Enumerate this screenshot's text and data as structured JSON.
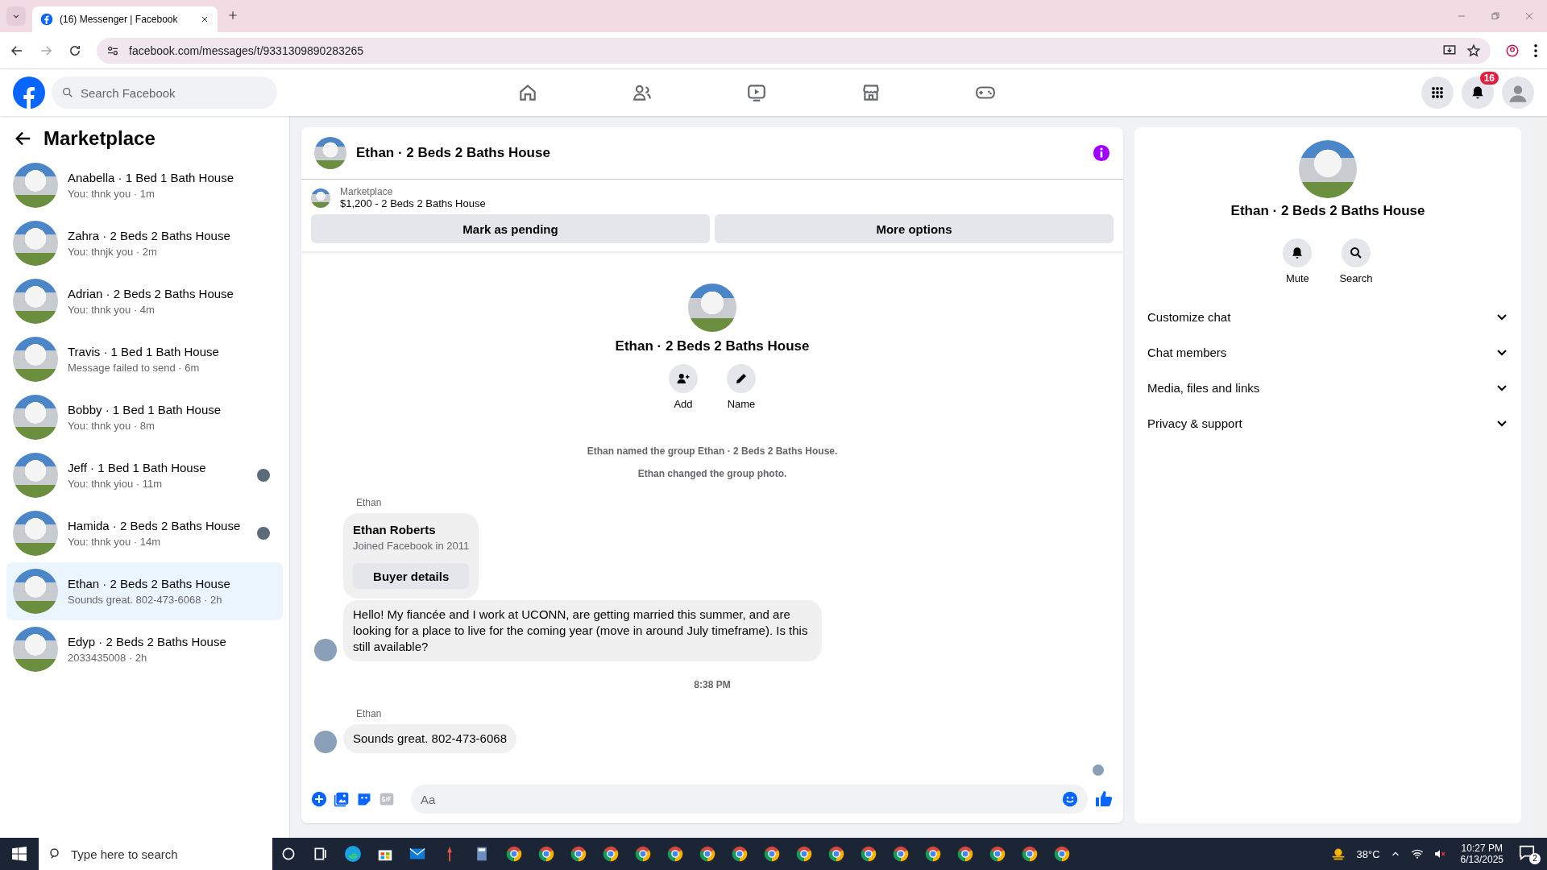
{
  "browser": {
    "tab_title": "(16) Messenger | Facebook",
    "url": "facebook.com/messages/t/9331309890283265"
  },
  "header": {
    "search_placeholder": "Search Facebook",
    "notification_count": "16"
  },
  "sidebar": {
    "title": "Marketplace",
    "conversations": [
      {
        "title": "Anabella · 1 Bed 1 Bath House",
        "preview": "You: thnk you · 1m",
        "selected": false,
        "seen": false
      },
      {
        "title": "Zahra · 2 Beds 2 Baths House",
        "preview": "You: thnjk you · 2m",
        "selected": false,
        "seen": false
      },
      {
        "title": "Adrian · 2 Beds 2 Baths House",
        "preview": "You: thnk you · 4m",
        "selected": false,
        "seen": false
      },
      {
        "title": "Travis · 1 Bed 1 Bath House",
        "preview": "Message failed to send · 6m",
        "selected": false,
        "seen": false
      },
      {
        "title": "Bobby · 1 Bed 1 Bath House",
        "preview": "You: thnk you · 8m",
        "selected": false,
        "seen": false
      },
      {
        "title": "Jeff · 1 Bed 1 Bath House",
        "preview": "You: thnk yiou · 11m",
        "selected": false,
        "seen": true
      },
      {
        "title": "Hamida · 2 Beds 2 Baths House",
        "preview": "You: thnk you · 14m",
        "selected": false,
        "seen": true
      },
      {
        "title": "Ethan · 2 Beds 2 Baths House",
        "preview": "Sounds great. 802-473-6068 · 2h",
        "selected": true,
        "seen": false
      },
      {
        "title": "Edyp · 2 Beds 2 Baths House",
        "preview": "2033435008 · 2h",
        "selected": false,
        "seen": false
      }
    ]
  },
  "chat": {
    "title": "Ethan · 2 Beds 2 Baths House",
    "listing": {
      "source": "Marketplace",
      "text": "$1,200 - 2 Beds 2 Baths House"
    },
    "buttons": [
      "Mark as pending",
      "More options"
    ],
    "group": {
      "name": "Ethan · 2 Beds 2 Baths House",
      "actions": [
        {
          "kind": "add",
          "label": "Add"
        },
        {
          "kind": "name",
          "label": "Name"
        }
      ]
    },
    "events": [
      "Ethan named the group Ethan · 2 Beds 2 Baths House.",
      "Ethan changed the group photo."
    ],
    "thread": [
      {
        "kind": "sender",
        "text": "Ethan"
      },
      {
        "kind": "profile",
        "name": "Ethan Roberts",
        "subtitle": "Joined Facebook in 2011",
        "button": "Buyer details"
      },
      {
        "kind": "message",
        "text": "Hello! My fiancée and I work at UCONN, are getting married this summer, and are looking for a place to live for the coming year (move in around July timeframe). Is this still available?"
      },
      {
        "kind": "time",
        "text": "8:38 PM"
      },
      {
        "kind": "sender",
        "text": "Ethan"
      },
      {
        "kind": "message",
        "text": "Sounds great. 802-473-6068"
      }
    ],
    "composer_placeholder": "Aa"
  },
  "details": {
    "name": "Ethan · 2 Beds 2 Baths House",
    "actions": [
      {
        "kind": "mute",
        "label": "Mute"
      },
      {
        "kind": "search",
        "label": "Search"
      }
    ],
    "sections": [
      {
        "label": "Customize chat",
        "expanded": false
      },
      {
        "label": "Chat members",
        "expanded": false
      },
      {
        "label": "Media, files and links",
        "expanded": false
      },
      {
        "label": "Privacy & support",
        "expanded": false
      }
    ]
  },
  "taskbar": {
    "search_placeholder": "Type here to search",
    "temperature": "38°C",
    "time": "10:27 PM",
    "date": "6/13/2025",
    "notification_count": "2"
  }
}
